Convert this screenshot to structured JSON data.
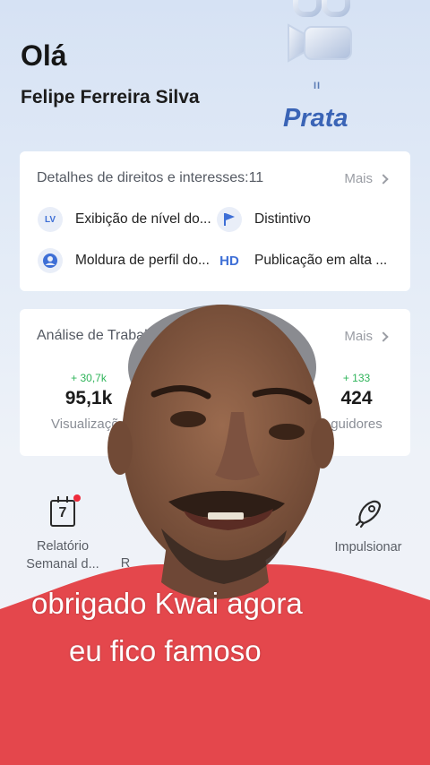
{
  "header": {
    "greeting": "Olá",
    "username": "Felipe Ferreira Silva",
    "level_roman": "II",
    "level_name": "Prata"
  },
  "rights_card": {
    "title": "Detalhes de direitos e interesses:11",
    "more_label": "Mais",
    "perks": [
      {
        "icon": "lv-badge-icon",
        "icon_text": "LV",
        "label": "Exibição de nível do..."
      },
      {
        "icon": "flag-icon",
        "label": "Distintivo"
      },
      {
        "icon": "profile-frame-icon",
        "label": "Moldura de perfil do..."
      },
      {
        "icon": "hd-icon",
        "icon_text": "HD",
        "label": "Publicação em alta ..."
      }
    ]
  },
  "work_card": {
    "title": "Análise de Trabal",
    "more_label": "Mais",
    "stats": [
      {
        "delta": "+ 30,7k",
        "value": "95,1k",
        "label": "Visualizaçõe"
      },
      {
        "delta": "+ 133",
        "value": "424",
        "label": "guidores"
      }
    ]
  },
  "tools": [
    {
      "icon": "calendar-icon",
      "icon_text": "7",
      "label_line1": "Relatório",
      "label_line2": "Semanal d...",
      "has_notification_dot": true
    },
    {
      "icon": "rocket-icon",
      "label_line1": "Impulsionar",
      "label_line2": ""
    }
  ],
  "tools_partial_label": "R",
  "caption": {
    "line1": "obrigado Kwai agora",
    "line2": "eu fico famoso"
  },
  "colors": {
    "accent_blue": "#3a64b6",
    "delta_green": "#2fb45a",
    "notification_red": "#ee2a3b",
    "shirt_red": "#e4474c"
  }
}
